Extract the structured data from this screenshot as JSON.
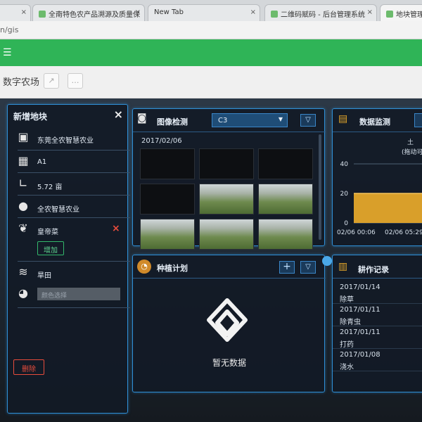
{
  "browser": {
    "tabs": [
      {
        "label": "全南特色农产品溯源及质量保",
        "active": false
      },
      {
        "label": "New Tab",
        "active": false
      },
      {
        "label": "二维码赋码 - 后台管理系统",
        "active": false
      },
      {
        "label": "地块管理",
        "active": true
      }
    ],
    "url": "n/gis"
  },
  "header": {
    "menu_icon": "☰"
  },
  "subbar": {
    "title": "数字农场"
  },
  "plot_panel": {
    "title": "新增地块",
    "close": "×",
    "rows": {
      "company": "东莞全农智慧农业",
      "code": "A1",
      "area": "5.72 亩",
      "owner": "全农智慧农业",
      "crop": "皇帝菜",
      "field_type": "旱田",
      "color_placeholder": "颜色选择"
    },
    "add_label": "增加",
    "remove_crop": "×",
    "delete_label": "删除"
  },
  "image_panel": {
    "title": "图像检测",
    "camera": "C3",
    "date": "2017/02/06",
    "thumbs": [
      "dark",
      "dark",
      "dark",
      "dark",
      "field",
      "field",
      "field",
      "field",
      "field"
    ]
  },
  "monitor_panel": {
    "title": "数据监测",
    "legend_title": "土",
    "legend_sub": "(拖动可",
    "chart_data": {
      "type": "area",
      "x": [
        "02/06 00:06",
        "02/06 05:29"
      ],
      "yticks": [
        0,
        20,
        40
      ],
      "ylim": [
        0,
        40
      ],
      "series": [
        {
          "values": [
            20,
            20
          ]
        }
      ],
      "color": "#e4a72a"
    }
  },
  "plan_panel": {
    "title": "种植计划",
    "empty_text": "暂无数据",
    "add": "+"
  },
  "records_panel": {
    "title": "耕作记录",
    "items": [
      {
        "date": "2017/01/14",
        "action": "除草"
      },
      {
        "date": "2017/01/11",
        "action": "除青虫"
      },
      {
        "date": "2017/01/11",
        "action": "打药"
      },
      {
        "date": "2017/01/08",
        "action": "浇水"
      }
    ]
  }
}
